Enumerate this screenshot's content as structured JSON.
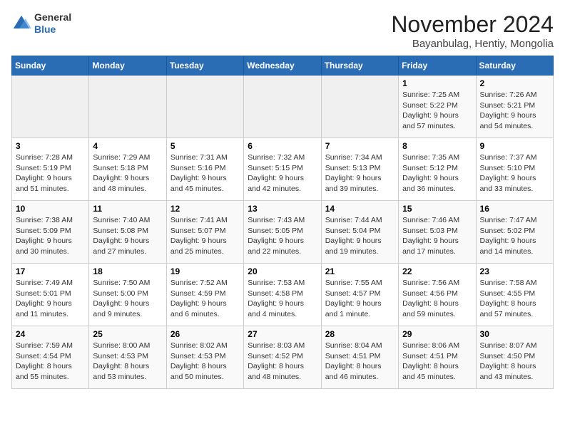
{
  "logo": {
    "general": "General",
    "blue": "Blue"
  },
  "title": "November 2024",
  "location": "Bayanbulag, Hentiy, Mongolia",
  "days_of_week": [
    "Sunday",
    "Monday",
    "Tuesday",
    "Wednesday",
    "Thursday",
    "Friday",
    "Saturday"
  ],
  "weeks": [
    [
      {
        "day": "",
        "empty": true
      },
      {
        "day": "",
        "empty": true
      },
      {
        "day": "",
        "empty": true
      },
      {
        "day": "",
        "empty": true
      },
      {
        "day": "",
        "empty": true
      },
      {
        "day": "1",
        "sunrise": "7:25 AM",
        "sunset": "5:22 PM",
        "daylight": "9 hours and 57 minutes."
      },
      {
        "day": "2",
        "sunrise": "7:26 AM",
        "sunset": "5:21 PM",
        "daylight": "9 hours and 54 minutes."
      }
    ],
    [
      {
        "day": "3",
        "sunrise": "7:28 AM",
        "sunset": "5:19 PM",
        "daylight": "9 hours and 51 minutes."
      },
      {
        "day": "4",
        "sunrise": "7:29 AM",
        "sunset": "5:18 PM",
        "daylight": "9 hours and 48 minutes."
      },
      {
        "day": "5",
        "sunrise": "7:31 AM",
        "sunset": "5:16 PM",
        "daylight": "9 hours and 45 minutes."
      },
      {
        "day": "6",
        "sunrise": "7:32 AM",
        "sunset": "5:15 PM",
        "daylight": "9 hours and 42 minutes."
      },
      {
        "day": "7",
        "sunrise": "7:34 AM",
        "sunset": "5:13 PM",
        "daylight": "9 hours and 39 minutes."
      },
      {
        "day": "8",
        "sunrise": "7:35 AM",
        "sunset": "5:12 PM",
        "daylight": "9 hours and 36 minutes."
      },
      {
        "day": "9",
        "sunrise": "7:37 AM",
        "sunset": "5:10 PM",
        "daylight": "9 hours and 33 minutes."
      }
    ],
    [
      {
        "day": "10",
        "sunrise": "7:38 AM",
        "sunset": "5:09 PM",
        "daylight": "9 hours and 30 minutes."
      },
      {
        "day": "11",
        "sunrise": "7:40 AM",
        "sunset": "5:08 PM",
        "daylight": "9 hours and 27 minutes."
      },
      {
        "day": "12",
        "sunrise": "7:41 AM",
        "sunset": "5:07 PM",
        "daylight": "9 hours and 25 minutes."
      },
      {
        "day": "13",
        "sunrise": "7:43 AM",
        "sunset": "5:05 PM",
        "daylight": "9 hours and 22 minutes."
      },
      {
        "day": "14",
        "sunrise": "7:44 AM",
        "sunset": "5:04 PM",
        "daylight": "9 hours and 19 minutes."
      },
      {
        "day": "15",
        "sunrise": "7:46 AM",
        "sunset": "5:03 PM",
        "daylight": "9 hours and 17 minutes."
      },
      {
        "day": "16",
        "sunrise": "7:47 AM",
        "sunset": "5:02 PM",
        "daylight": "9 hours and 14 minutes."
      }
    ],
    [
      {
        "day": "17",
        "sunrise": "7:49 AM",
        "sunset": "5:01 PM",
        "daylight": "9 hours and 11 minutes."
      },
      {
        "day": "18",
        "sunrise": "7:50 AM",
        "sunset": "5:00 PM",
        "daylight": "9 hours and 9 minutes."
      },
      {
        "day": "19",
        "sunrise": "7:52 AM",
        "sunset": "4:59 PM",
        "daylight": "9 hours and 6 minutes."
      },
      {
        "day": "20",
        "sunrise": "7:53 AM",
        "sunset": "4:58 PM",
        "daylight": "9 hours and 4 minutes."
      },
      {
        "day": "21",
        "sunrise": "7:55 AM",
        "sunset": "4:57 PM",
        "daylight": "9 hours and 1 minute."
      },
      {
        "day": "22",
        "sunrise": "7:56 AM",
        "sunset": "4:56 PM",
        "daylight": "8 hours and 59 minutes."
      },
      {
        "day": "23",
        "sunrise": "7:58 AM",
        "sunset": "4:55 PM",
        "daylight": "8 hours and 57 minutes."
      }
    ],
    [
      {
        "day": "24",
        "sunrise": "7:59 AM",
        "sunset": "4:54 PM",
        "daylight": "8 hours and 55 minutes."
      },
      {
        "day": "25",
        "sunrise": "8:00 AM",
        "sunset": "4:53 PM",
        "daylight": "8 hours and 53 minutes."
      },
      {
        "day": "26",
        "sunrise": "8:02 AM",
        "sunset": "4:53 PM",
        "daylight": "8 hours and 50 minutes."
      },
      {
        "day": "27",
        "sunrise": "8:03 AM",
        "sunset": "4:52 PM",
        "daylight": "8 hours and 48 minutes."
      },
      {
        "day": "28",
        "sunrise": "8:04 AM",
        "sunset": "4:51 PM",
        "daylight": "8 hours and 46 minutes."
      },
      {
        "day": "29",
        "sunrise": "8:06 AM",
        "sunset": "4:51 PM",
        "daylight": "8 hours and 45 minutes."
      },
      {
        "day": "30",
        "sunrise": "8:07 AM",
        "sunset": "4:50 PM",
        "daylight": "8 hours and 43 minutes."
      }
    ]
  ]
}
